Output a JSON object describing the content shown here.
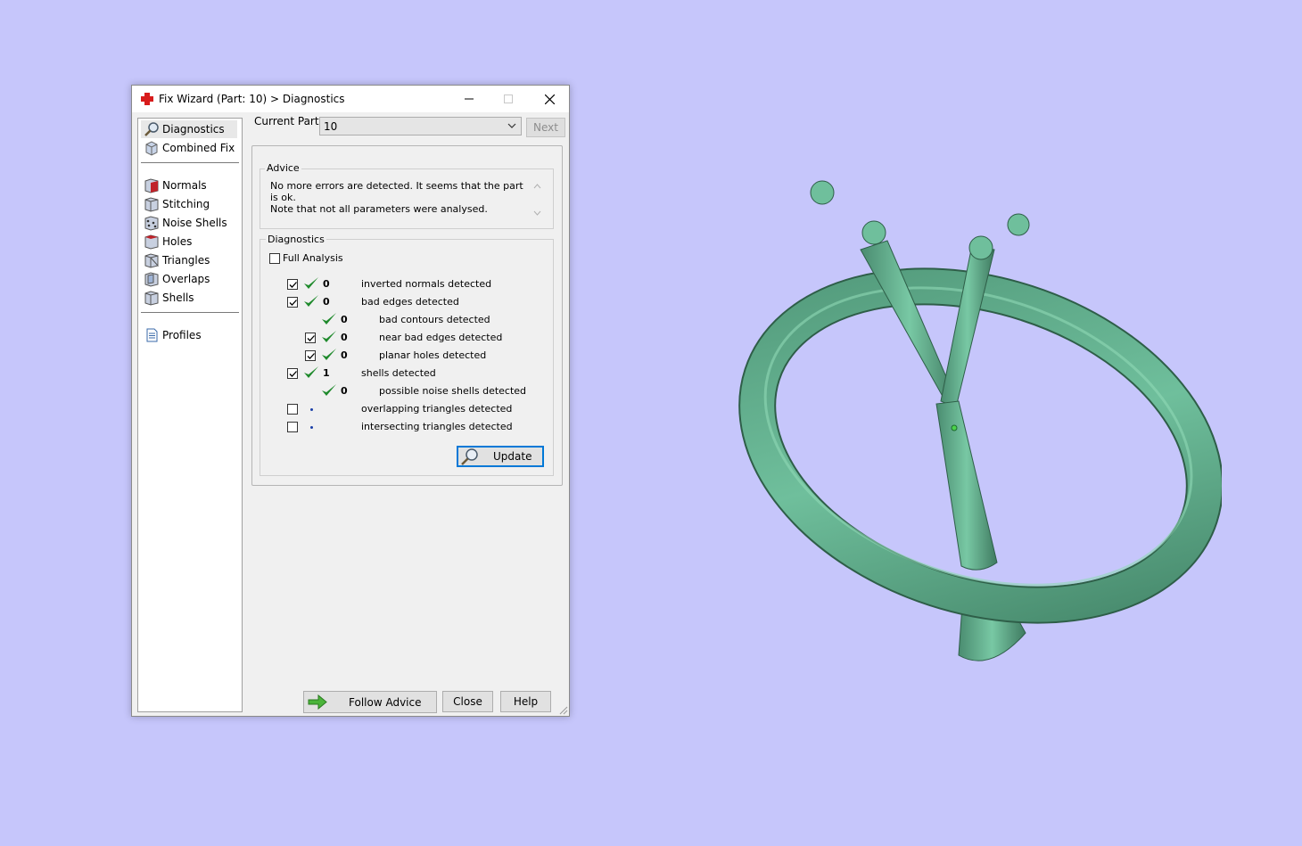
{
  "window": {
    "title": "Fix Wizard (Part: 10) > Diagnostics"
  },
  "sidebar": {
    "items": [
      {
        "label": "Diagnostics",
        "icon": "magnifier-icon",
        "selected": true
      },
      {
        "label": "Combined Fix",
        "icon": "combined-fix-icon"
      },
      {
        "label": "Normals",
        "icon": "normals-icon"
      },
      {
        "label": "Stitching",
        "icon": "stitching-icon"
      },
      {
        "label": "Noise Shells",
        "icon": "noise-shells-icon"
      },
      {
        "label": "Holes",
        "icon": "holes-icon"
      },
      {
        "label": "Triangles",
        "icon": "triangles-icon"
      },
      {
        "label": "Overlaps",
        "icon": "overlaps-icon"
      },
      {
        "label": "Shells",
        "icon": "shells-icon"
      },
      {
        "label": "Profiles",
        "icon": "document-icon"
      }
    ]
  },
  "current_part": {
    "label": "Current Part:",
    "value": "10",
    "next_label": "Next"
  },
  "advice": {
    "title": "Advice",
    "line1": "No more errors are detected. It seems that the part is ok.",
    "line2": "Note that not all parameters were analysed."
  },
  "diagnostics": {
    "title": "Diagnostics",
    "full_analysis_label": "Full Analysis",
    "full_analysis_checked": false,
    "rows": [
      {
        "checked": true,
        "status": "ok",
        "count": "0",
        "label": "inverted normals detected"
      },
      {
        "checked": true,
        "status": "ok",
        "count": "0",
        "label": "bad edges detected"
      },
      {
        "checked": null,
        "status": "ok",
        "count": "0",
        "label": "bad contours detected"
      },
      {
        "checked": true,
        "status": "ok",
        "count": "0",
        "label": "near bad edges detected"
      },
      {
        "checked": true,
        "status": "ok",
        "count": "0",
        "label": "planar holes detected"
      },
      {
        "checked": true,
        "status": "ok",
        "count": "1",
        "label": "shells detected"
      },
      {
        "checked": null,
        "status": "ok",
        "count": "0",
        "label": "possible noise shells detected"
      },
      {
        "checked": false,
        "status": "pending",
        "count": "",
        "label": "overlapping triangles detected"
      },
      {
        "checked": false,
        "status": "pending",
        "count": "",
        "label": "intersecting triangles detected"
      }
    ],
    "update_label": "Update"
  },
  "footer": {
    "follow_advice": "Follow Advice",
    "close": "Close",
    "help": "Help"
  },
  "colors": {
    "background": "#c6c6fb",
    "model": "#5fa888",
    "check": "#1f8a2c"
  }
}
